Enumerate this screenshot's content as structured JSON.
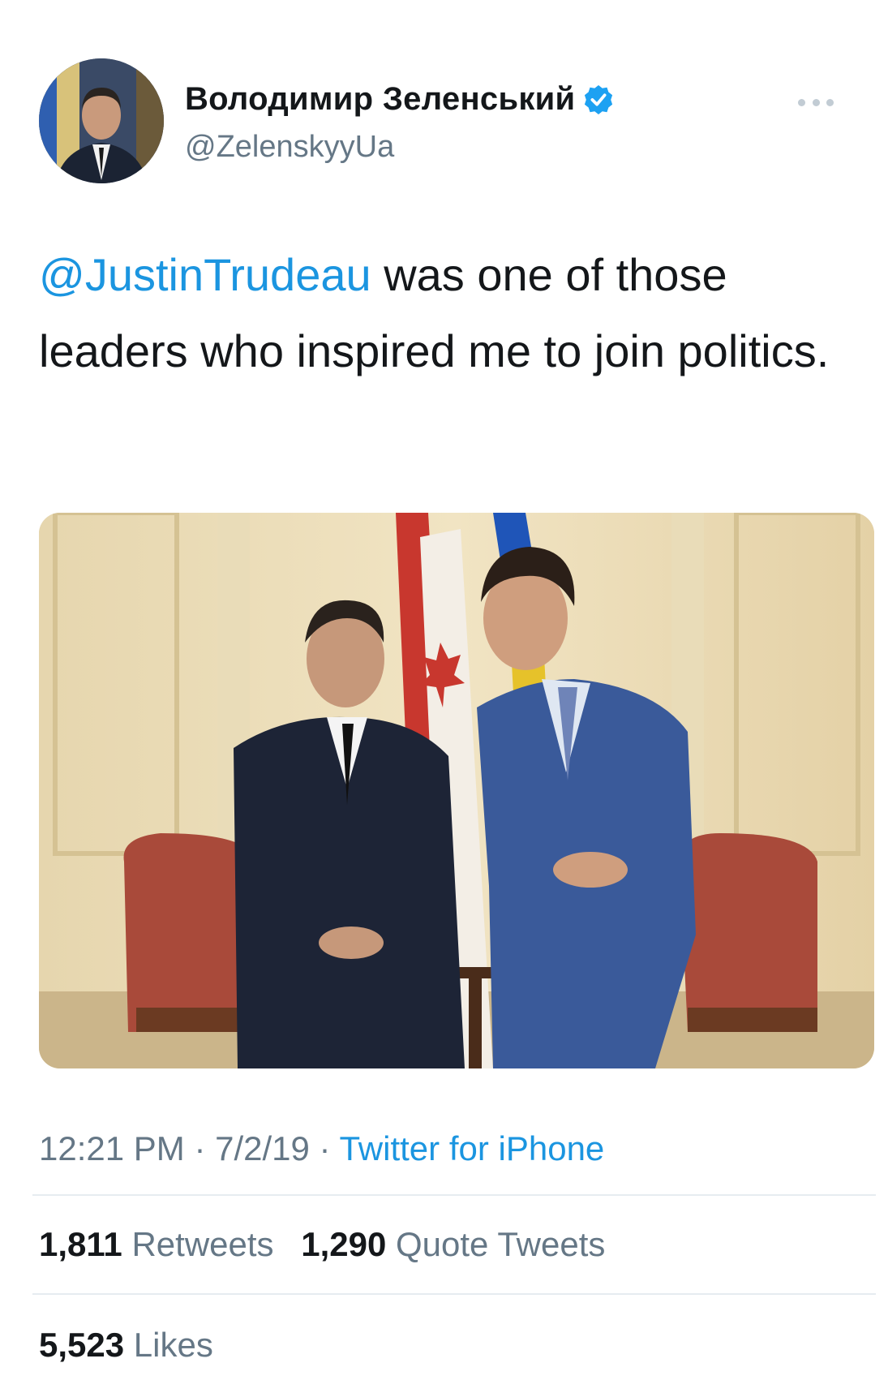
{
  "author": {
    "display_name": "Володимир Зеленський",
    "handle": "@ZelenskyyUa",
    "verified": true
  },
  "tweet": {
    "mention": "@JustinTrudeau",
    "text": " was one of those leaders who inspired me to join politics."
  },
  "meta": {
    "time": "12:21 PM",
    "separator": " · ",
    "date": "7/2/19",
    "source": "Twitter for iPhone"
  },
  "stats": {
    "retweets_count": "1,811",
    "retweets_label": "Retweets",
    "quotes_count": "1,290",
    "quotes_label": "Quote Tweets",
    "likes_count": "5,523",
    "likes_label": "Likes"
  },
  "icons": {
    "verified": "verified-badge-icon",
    "more": "more-options-icon"
  },
  "colors": {
    "link": "#1b95e0",
    "secondary_text": "#657786",
    "divider": "#e6ecf0"
  }
}
